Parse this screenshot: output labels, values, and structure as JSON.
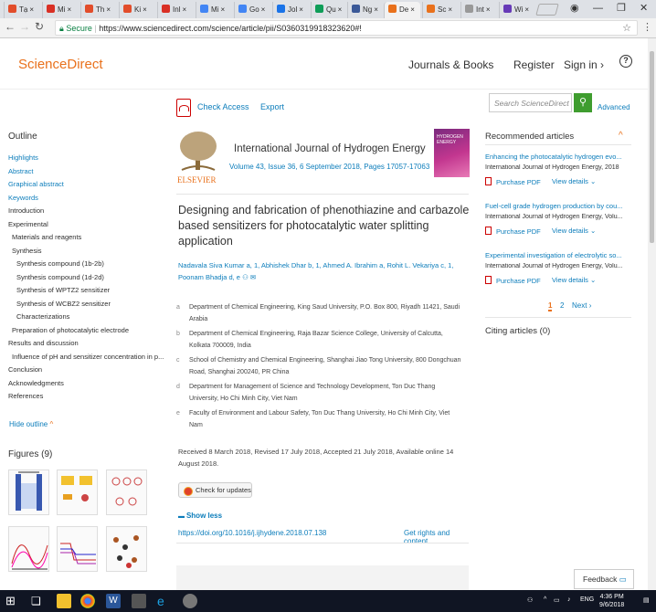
{
  "browser": {
    "tabs": [
      {
        "label": "Tạ",
        "color": "#e24d2b"
      },
      {
        "label": "Mi",
        "color": "#d93025"
      },
      {
        "label": "Th",
        "color": "#e24d2b"
      },
      {
        "label": "Ki",
        "color": "#e24d2b"
      },
      {
        "label": "Inl",
        "color": "#d93025"
      },
      {
        "label": "Mi",
        "color": "#4285f4"
      },
      {
        "label": "Go",
        "color": "#4285f4"
      },
      {
        "label": "Jol",
        "color": "#1a73e8"
      },
      {
        "label": "Qu",
        "color": "#0f9d58"
      },
      {
        "label": "Ng",
        "color": "#3b5998"
      },
      {
        "label": "De",
        "color": "#e9711c"
      },
      {
        "label": "Sc",
        "color": "#e9711c"
      },
      {
        "label": "Int",
        "color": "#999999"
      },
      {
        "label": "Wi",
        "color": "#673ab7"
      }
    ],
    "secure_label": "Secure",
    "url": "https://www.sciencedirect.com/science/article/pii/S0360319918323620#!"
  },
  "header": {
    "logo": "ScienceDirect",
    "journals_books": "Journals & Books",
    "register": "Register",
    "sign_in": "Sign in",
    "help": "?"
  },
  "actions": {
    "check_access": "Check Access",
    "export": "Export",
    "search_placeholder": "Search ScienceDirect",
    "advanced": "Advanced"
  },
  "outline": {
    "title": "Outline",
    "items": [
      {
        "label": "Highlights",
        "link": true,
        "indent": 0
      },
      {
        "label": "Abstract",
        "link": true,
        "indent": 0
      },
      {
        "label": "Graphical abstract",
        "link": true,
        "indent": 0
      },
      {
        "label": "Keywords",
        "link": true,
        "indent": 0
      },
      {
        "label": "Introduction",
        "link": false,
        "indent": 0
      },
      {
        "label": "Experimental",
        "link": false,
        "indent": 0
      },
      {
        "label": "Materials and reagents",
        "link": false,
        "indent": 1
      },
      {
        "label": "Synthesis",
        "link": false,
        "indent": 1
      },
      {
        "label": "Synthesis compound (1b-2b)",
        "link": false,
        "indent": 2
      },
      {
        "label": "Synthesis compound (1d-2d)",
        "link": false,
        "indent": 2
      },
      {
        "label": "Synthesis of WPTZ2 sensitizer",
        "link": false,
        "indent": 2
      },
      {
        "label": "Synthesis of WCBZ2 sensitizer",
        "link": false,
        "indent": 2
      },
      {
        "label": "Characterizations",
        "link": false,
        "indent": 2
      },
      {
        "label": "Preparation of photocatalytic electrode",
        "link": false,
        "indent": 1
      },
      {
        "label": "Results and discussion",
        "link": false,
        "indent": 0
      },
      {
        "label": "Influence of pH and sensitizer concentration in p...",
        "link": false,
        "indent": 1
      },
      {
        "label": "Conclusion",
        "link": false,
        "indent": 0
      },
      {
        "label": "Acknowledgments",
        "link": false,
        "indent": 0
      },
      {
        "label": "References",
        "link": false,
        "indent": 0
      }
    ],
    "hide_outline": "Hide outline",
    "figures_title": "Figures (9)"
  },
  "article": {
    "publisher": "ELSEVIER",
    "journal": "International Journal of Hydrogen Energy",
    "journal_meta": "Volume 43, Issue 36, 6 September 2018, Pages 17057-17063",
    "cover_text": "HYDROGEN ENERGY",
    "title": "Designing and fabrication of phenothiazine and carbazole based sensitizers for photocatalytic water splitting application",
    "authors": "Nadavala Siva Kumar a, 1, Abhishek Dhar b, 1, Ahmed A. Ibrahim a, Rohit L. Vekariya c, 1, Poonam Bhadja d, e",
    "affiliations": [
      {
        "sup": "a",
        "text": "Department of Chemical Engineering, King Saud University, P.O. Box 800, Riyadh 11421, Saudi Arabia"
      },
      {
        "sup": "b",
        "text": "Department of Chemical Engineering, Raja Bazar Science College, University of Calcutta, Kolkata 700009, India"
      },
      {
        "sup": "c",
        "text": "School of Chemistry and Chemical Engineering, Shanghai Jiao Tong University, 800 Dongchuan Road, Shanghai 200240, PR China"
      },
      {
        "sup": "d",
        "text": "Department for Management of Science and Technology Development, Ton Duc Thang University, Ho Chi Minh City, Viet Nam"
      },
      {
        "sup": "e",
        "text": "Faculty of Environment and Labour Safety, Ton Duc Thang University, Ho Chi Minh City, Viet Nam"
      }
    ],
    "dates": "Received 8 March 2018, Revised 17 July 2018, Accepted 21 July 2018, Available online 14 August 2018.",
    "check_updates": "Check for updates",
    "show_less": "Show less",
    "doi": "https://doi.org/10.1016/j.ijhydene.2018.07.138",
    "rights": "Get rights and content"
  },
  "recommended": {
    "title": "Recommended articles",
    "items": [
      {
        "title": "Enhancing the photocatalytic hydrogen evo...",
        "source": "International Journal of Hydrogen Energy, 2018",
        "pdf": "Purchase PDF",
        "view": "View details"
      },
      {
        "title": "Fuel-cell grade hydrogen production by cou...",
        "source": "International Journal of Hydrogen Energy, Volu...",
        "pdf": "Purchase PDF",
        "view": "View details"
      },
      {
        "title": "Experimental investigation of electrolytic so...",
        "source": "International Journal of Hydrogen Energy, Volu...",
        "pdf": "Purchase PDF",
        "view": "View details"
      }
    ],
    "page1": "1",
    "page2": "2",
    "next": "Next",
    "citing": "Citing articles (0)"
  },
  "feedback": "Feedback",
  "taskbar": {
    "lang": "ENG",
    "time": "4:36 PM",
    "date": "9/6/2018"
  }
}
